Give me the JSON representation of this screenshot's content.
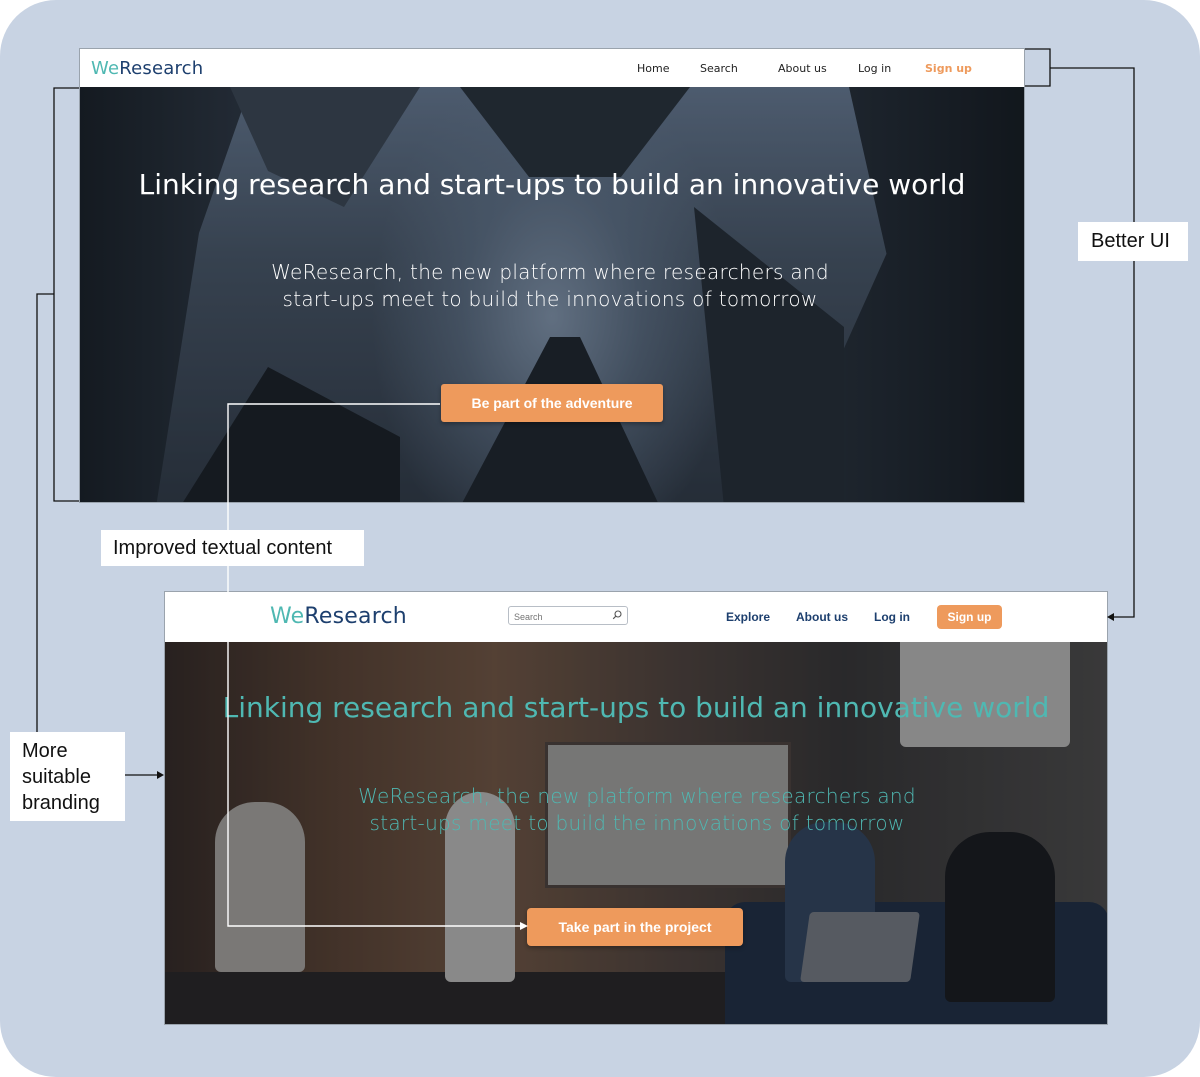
{
  "colors": {
    "canvas_bg": "#c8d3e3",
    "brand_teal": "#4fb8b2",
    "brand_navy": "#1d3f6e",
    "accent_orange": "#ee9a5c"
  },
  "annotations": {
    "better_ui": "Better UI",
    "improved_text": "Improved textual content",
    "branding": "More suitable branding"
  },
  "mockup_old": {
    "logo_we": "We",
    "logo_research": "Research",
    "nav": [
      "Home",
      "Search",
      "About us",
      "Log in",
      "Sign up"
    ],
    "headline": "Linking research and start-ups to build an innovative world",
    "subtitle": "WeResearch, the new platform where researchers and start-ups meet to build the innovations of tomorrow",
    "cta": "Be part of the adventure"
  },
  "mockup_new": {
    "logo_we": "We",
    "logo_research": "Research",
    "search_placeholder": "Search",
    "nav": [
      "Explore",
      "About us",
      "Log in"
    ],
    "signup": "Sign up",
    "headline": "Linking research and start-ups to build an innovative world",
    "subtitle": "WeResearch, the new platform where researchers and start-ups meet to build the innovations of tomorrow",
    "cta": "Take part in the project"
  }
}
